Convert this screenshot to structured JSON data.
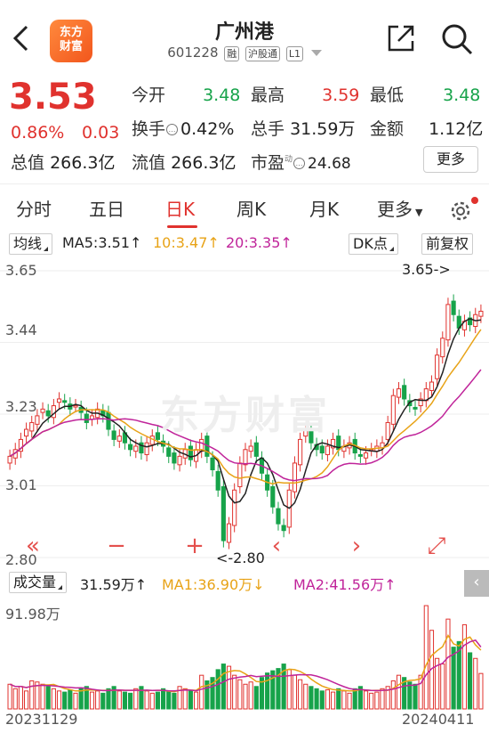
{
  "header": {
    "logo_line1": "东方",
    "logo_line2": "财富",
    "stock_name": "广州港",
    "stock_code": "601228",
    "tags": [
      "融",
      "沪股通",
      "L1"
    ]
  },
  "quote": {
    "price": "3.53",
    "change_pct": "0.86%",
    "change": "0.03",
    "open_label": "今开",
    "open": "3.48",
    "high_label": "最高",
    "high": "3.59",
    "low_label": "最低",
    "low": "3.48",
    "turnover_label": "换手",
    "turnover": "0.42%",
    "volume_label": "总手",
    "volume": "31.59万",
    "amount_label": "金额",
    "amount": "1.12亿",
    "mktcap_label": "总值",
    "mktcap": "266.3亿",
    "float_label": "流值",
    "float": "266.3亿",
    "pe_label": "市盈",
    "pe_sup": "动",
    "pe": "24.68",
    "more_button": "更多"
  },
  "tabs": [
    "分时",
    "五日",
    "日K",
    "周K",
    "月K",
    "更多"
  ],
  "active_tab": "日K",
  "indicators": {
    "ma_selector": "均线",
    "ma5": "MA5:3.51↑",
    "ma10": "10:3.47↑",
    "ma20": "20:3.35↑",
    "dk_button": "DK点",
    "adjust_button": "前复权"
  },
  "kline": {
    "y_labels": [
      "3.65",
      "3.44",
      "3.23",
      "3.01",
      "2.80"
    ],
    "watermark": "东方财富",
    "max_annotation": "3.65->",
    "min_annotation": "<-2.80"
  },
  "volume": {
    "selector": "成交量",
    "vol": "31.59万↑",
    "ma1": "MA1:36.90万↓",
    "ma2": "MA2:41.56万↑",
    "max_label": "91.98万"
  },
  "dates": {
    "start": "20231129",
    "end": "20240411"
  },
  "colors": {
    "up": "#e0322e",
    "down": "#17a34a",
    "ma5": "#222222",
    "ma10": "#e8a317",
    "ma20": "#c0249a"
  },
  "chart_data": {
    "type": "candlestick",
    "ylim": [
      2.8,
      3.65
    ],
    "closes": [
      3.1,
      3.12,
      3.15,
      3.18,
      3.2,
      3.22,
      3.24,
      3.22,
      3.25,
      3.27,
      3.26,
      3.24,
      3.25,
      3.23,
      3.2,
      3.22,
      3.24,
      3.22,
      3.18,
      3.15,
      3.16,
      3.14,
      3.12,
      3.13,
      3.11,
      3.14,
      3.16,
      3.15,
      3.13,
      3.1,
      3.08,
      3.1,
      3.12,
      3.09,
      3.12,
      3.15,
      3.1,
      3.06,
      3.0,
      2.85,
      2.9,
      3.0,
      3.08,
      3.12,
      3.13,
      3.1,
      3.05,
      3.0,
      2.95,
      2.9,
      2.88,
      3.0,
      3.08,
      3.15,
      3.18,
      3.14,
      3.12,
      3.11,
      3.13,
      3.15,
      3.12,
      3.13,
      3.14,
      3.11,
      3.1,
      3.11,
      3.12,
      3.13,
      3.14,
      3.2,
      3.28,
      3.3,
      3.27,
      3.25,
      3.24,
      3.27,
      3.3,
      3.32,
      3.4,
      3.45,
      3.55,
      3.52,
      3.48,
      3.5,
      3.49,
      3.52,
      3.53
    ],
    "volumes": [
      22,
      18,
      20,
      16,
      25,
      24,
      22,
      20,
      18,
      16,
      15,
      17,
      14,
      18,
      20,
      15,
      16,
      14,
      18,
      20,
      16,
      15,
      14,
      18,
      20,
      16,
      14,
      15,
      18,
      16,
      14,
      20,
      18,
      16,
      15,
      30,
      25,
      28,
      35,
      40,
      38,
      30,
      26,
      22,
      24,
      20,
      28,
      32,
      34,
      36,
      40,
      35,
      30,
      26,
      22,
      20,
      18,
      16,
      17,
      15,
      18,
      16,
      14,
      18,
      20,
      16,
      14,
      15,
      18,
      20,
      25,
      30,
      28,
      24,
      22,
      30,
      92,
      70,
      45,
      40,
      80,
      55,
      60,
      75,
      50,
      45,
      31.59
    ]
  }
}
